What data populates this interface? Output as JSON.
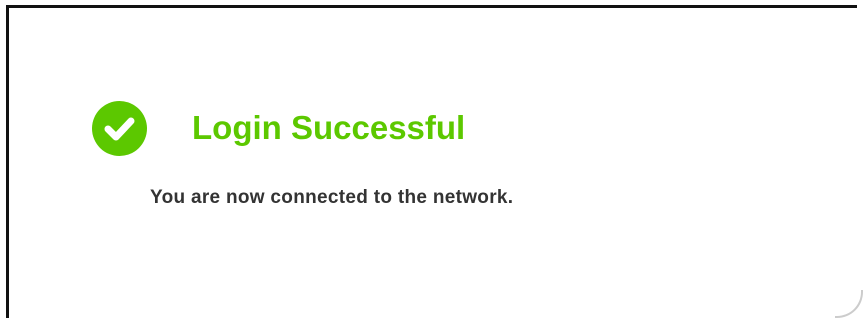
{
  "status": {
    "icon": "check-circle-icon",
    "title": "Login Successful",
    "message": "You are now connected to the network."
  },
  "colors": {
    "success": "#5cc800",
    "text": "#333333",
    "frame_border": "#111111"
  }
}
